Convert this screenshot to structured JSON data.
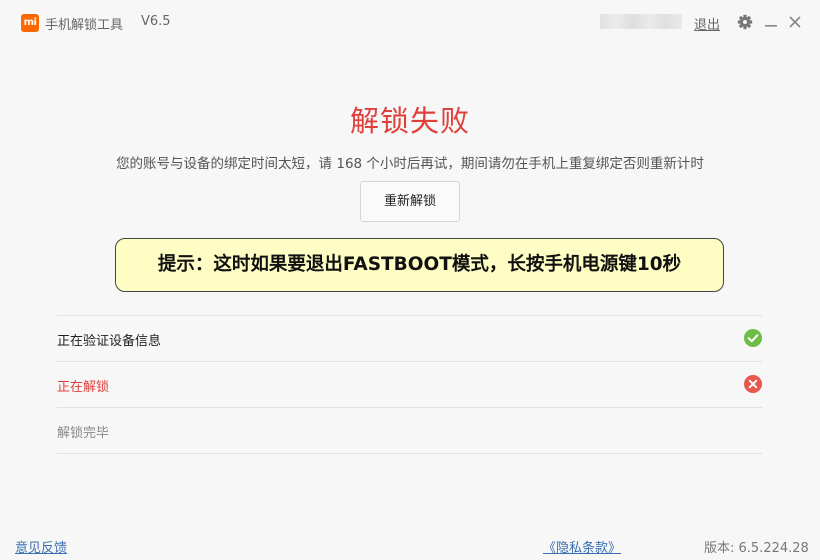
{
  "titlebar": {
    "logo_text": "mi",
    "app_title": "手机解锁工具",
    "version": "V6.5",
    "logout_label": "退出",
    "gear_icon": "gear-icon",
    "minimize_icon": "minimize-icon",
    "close_icon": "close-icon"
  },
  "main": {
    "title": "解锁失败",
    "message": "您的账号与设备的绑定时间太短，请 168 个小时后再试，期间请勿在手机上重复绑定否则重新计时",
    "retry_label": "重新解锁",
    "tip": "提示：这时如果要退出FASTBOOT模式，长按手机电源键10秒"
  },
  "steps": [
    {
      "label": "正在验证设备信息",
      "status": "success",
      "icon": "check-circle-icon"
    },
    {
      "label": "正在解锁",
      "status": "failed",
      "icon": "x-circle-icon"
    },
    {
      "label": "解锁完毕",
      "status": "pending",
      "icon": ""
    }
  ],
  "footer": {
    "feedback_label": "意见反馈",
    "privacy_label": "《隐私条款》",
    "version_info": "版本: 6.5.224.28"
  },
  "colors": {
    "error": "#e0403b",
    "success": "#6cbd45",
    "link": "#3a6fb0",
    "tip_background": "#fefec4",
    "brand": "#ff6700"
  }
}
